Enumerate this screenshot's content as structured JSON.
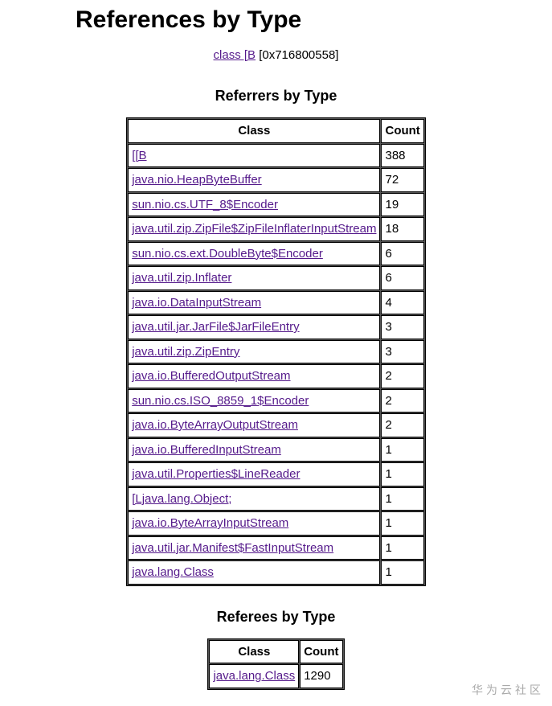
{
  "page_title": "References by Type",
  "subject": {
    "link_text": "class [B",
    "address": "[0x716800558]"
  },
  "referrers": {
    "title": "Referrers by Type",
    "columns": [
      "Class",
      "Count"
    ],
    "rows": [
      {
        "class": "[[B",
        "count": "388"
      },
      {
        "class": "java.nio.HeapByteBuffer",
        "count": "72"
      },
      {
        "class": "sun.nio.cs.UTF_8$Encoder",
        "count": "19"
      },
      {
        "class": "java.util.zip.ZipFile$ZipFileInflaterInputStream",
        "count": "18"
      },
      {
        "class": "sun.nio.cs.ext.DoubleByte$Encoder",
        "count": "6"
      },
      {
        "class": "java.util.zip.Inflater",
        "count": "6"
      },
      {
        "class": "java.io.DataInputStream",
        "count": "4"
      },
      {
        "class": "java.util.jar.JarFile$JarFileEntry",
        "count": "3"
      },
      {
        "class": "java.util.zip.ZipEntry",
        "count": "3"
      },
      {
        "class": "java.io.BufferedOutputStream",
        "count": "2"
      },
      {
        "class": "sun.nio.cs.ISO_8859_1$Encoder",
        "count": "2"
      },
      {
        "class": "java.io.ByteArrayOutputStream",
        "count": "2"
      },
      {
        "class": "java.io.BufferedInputStream",
        "count": "1"
      },
      {
        "class": "java.util.Properties$LineReader",
        "count": "1"
      },
      {
        "class": "[Ljava.lang.Object;",
        "count": "1"
      },
      {
        "class": "java.io.ByteArrayInputStream",
        "count": "1"
      },
      {
        "class": "java.util.jar.Manifest$FastInputStream",
        "count": "1"
      },
      {
        "class": "java.lang.Class",
        "count": "1"
      }
    ]
  },
  "referees": {
    "title": "Referees by Type",
    "columns": [
      "Class",
      "Count"
    ],
    "rows": [
      {
        "class": "java.lang.Class",
        "count": "1290"
      }
    ]
  },
  "watermark": "华为云社区"
}
